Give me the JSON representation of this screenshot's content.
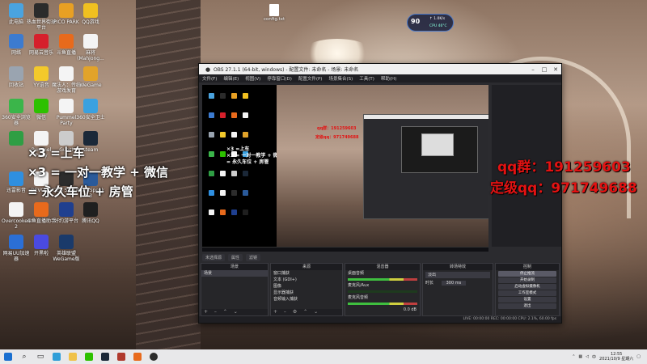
{
  "desktop_icons": [
    {
      "label": "此电脑",
      "color": "#4aa3df"
    },
    {
      "label": "热血世界街球平台",
      "color": "#2b2b2b"
    },
    {
      "label": "PICO PARK",
      "color": "#e8a023"
    },
    {
      "label": "QQ游戏",
      "color": "#f0c020"
    },
    {
      "label": "网络",
      "color": "#3c7bd0"
    },
    {
      "label": "网易云音乐",
      "color": "#d6202b"
    },
    {
      "label": "斗鱼直播",
      "color": "#e86a1c"
    },
    {
      "label": "麻将(Mahjong...",
      "color": "#f4f4f4"
    },
    {
      "label": "回收站",
      "color": "#9aa4b0"
    },
    {
      "label": "YY语音",
      "color": "#f3c92b"
    },
    {
      "label": "魔法人：传统游戏发育",
      "color": "#f4f4f4"
    },
    {
      "label": "WeGame",
      "color": "#e2a32a"
    },
    {
      "label": "360安全浏览器",
      "color": "#3bb54a"
    },
    {
      "label": "微信",
      "color": "#2dc100"
    },
    {
      "label": "Pummel Party",
      "color": "#f4f4f4"
    },
    {
      "label": "360安全卫士",
      "color": "#3aa1e0"
    },
    {
      "label": "",
      "color": "#2f9e44"
    },
    {
      "label": "Pummel Party",
      "color": "#f4f4f4"
    },
    {
      "label": "Guest",
      "color": "#cccccc"
    },
    {
      "label": "steam",
      "color": "#1b2838"
    },
    {
      "label": "迅雷影音",
      "color": "#2f8fe0"
    },
    {
      "label": "DEVOUR",
      "color": "#f4f4f4"
    },
    {
      "label": "OBS Studio",
      "color": "#2c2c2c"
    },
    {
      "label": "TeamSpeak 3",
      "color": "#2a5a9a"
    },
    {
      "label": "Overcooked! 2",
      "color": "#f4f4f4"
    },
    {
      "label": "斗鱼直播助手",
      "color": "#e86a1c"
    },
    {
      "label": "好约游平台",
      "color": "#1f3f8f"
    },
    {
      "label": "腾讯QQ",
      "color": "#1f1f1f"
    },
    {
      "label": "网易UU加速器",
      "color": "#2b6fd6"
    },
    {
      "label": "开黑啦",
      "color": "#4a4ae0"
    },
    {
      "label": "英雄联盟WeGame版",
      "color": "#1a3a6a"
    }
  ],
  "captions": {
    "line1": "×3 =上车",
    "line2": "×3 = 一对一教学 + 微信",
    "line3": "= 永久车位 + 房管",
    "qq_group": "qq群：191259603",
    "fixed_qq": "定级qq：971749688",
    "nested_qq_group": "qq群：191259603",
    "nested_fixed_qq": "定级qq：971749688"
  },
  "file": {
    "label": "config.txt"
  },
  "gauge": {
    "value": "90",
    "line1": "↑ 1.0K/s",
    "line2": "CPU 46°C"
  },
  "obs": {
    "title": "OBS 27.1.1 (64-bit, windows) - 配置文件: 未命名 - 场景: 未命名",
    "menu": [
      "文件(F)",
      "编辑(E)",
      "视图(V)",
      "停靠窗口(D)",
      "配置文件(P)",
      "场景集合(S)",
      "工具(T)",
      "帮助(H)"
    ],
    "tabs": [
      "未选择源",
      "属性",
      "滤镜"
    ],
    "scenes": {
      "title": "场景",
      "items": [
        "场景"
      ]
    },
    "sources": {
      "title": "来源",
      "items": [
        "窗口捕获",
        "文本 (GDI+)",
        "图像",
        "显示器捕获",
        "音频输入捕获"
      ]
    },
    "mixer": {
      "title": "混音器",
      "items": [
        "桌面音频",
        "麦克风/Aux",
        "麦克风音频"
      ],
      "level": "0.0 dB"
    },
    "transitions": {
      "title": "转场特效",
      "type": "淡出",
      "duration_label": "时长",
      "duration": "300 ms"
    },
    "controls": {
      "title": "控制",
      "buttons": [
        "停止推流",
        "开始录制",
        "启动虚拟摄像机",
        "工作室模式",
        "设置",
        "退出"
      ]
    },
    "status": "LIVE: 00:00:00   REC: 00:00:00   CPU: 2.1%, 60.00 fps"
  },
  "taskbar": {
    "time": "12:55",
    "date": "2021/10/9 星期六",
    "lang": "中"
  }
}
